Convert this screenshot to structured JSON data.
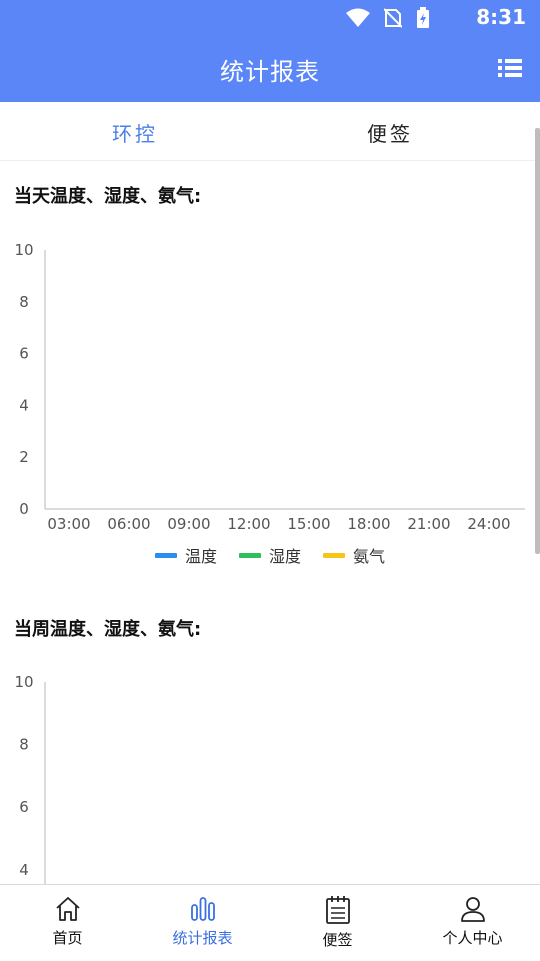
{
  "status": {
    "time": "8:31"
  },
  "app": {
    "title": "统计报表"
  },
  "tabs": [
    {
      "label": "环控",
      "active": true
    },
    {
      "label": "便签",
      "active": false
    }
  ],
  "colors": {
    "primary": "#5b86f7",
    "accent": "#4a7fe6",
    "temperature": "#2a8ef0",
    "humidity": "#2fbf5a",
    "ammonia": "#f5c518"
  },
  "charts": {
    "daily": {
      "title": "当天温度、湿度、氨气:",
      "legend": [
        "温度",
        "湿度",
        "氨气"
      ]
    },
    "weekly": {
      "title": "当周温度、湿度、氨气:"
    }
  },
  "chart_data": [
    {
      "type": "line",
      "title": "当天温度、湿度、氨气:",
      "x": [
        "03:00",
        "06:00",
        "09:00",
        "12:00",
        "15:00",
        "18:00",
        "21:00",
        "24:00"
      ],
      "y_ticks": [
        "0",
        "2",
        "4",
        "6",
        "8",
        "10"
      ],
      "ylim": [
        0,
        10
      ],
      "series": [
        {
          "name": "温度",
          "values": []
        },
        {
          "name": "湿度",
          "values": []
        },
        {
          "name": "氨气",
          "values": []
        }
      ],
      "legend_position": "bottom",
      "grid": false
    },
    {
      "type": "line",
      "title": "当周温度、湿度、氨气:",
      "y_ticks": [
        "4",
        "6",
        "8",
        "10"
      ],
      "ylim": [
        0,
        10
      ],
      "series": [],
      "grid": false
    }
  ],
  "nav": {
    "home": "首页",
    "stats": "统计报表",
    "notes": "便签",
    "profile": "个人中心",
    "active": "stats"
  }
}
